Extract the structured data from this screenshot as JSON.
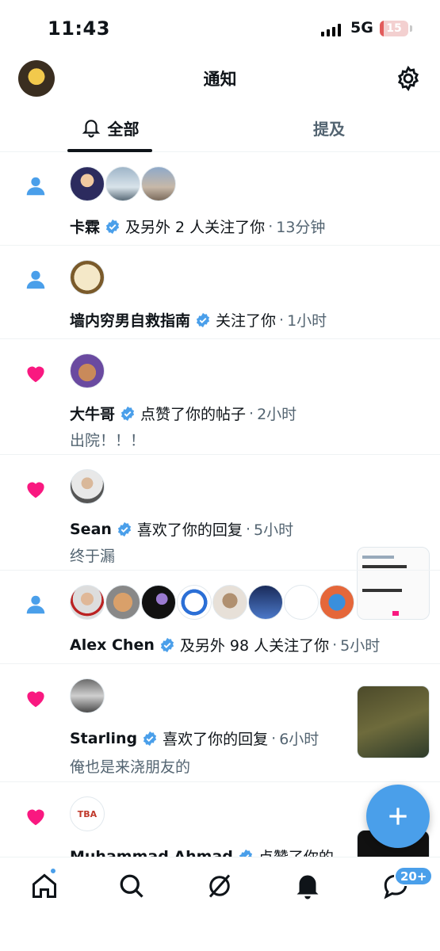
{
  "status_bar": {
    "time": "11:43",
    "network": "5G",
    "battery": "15",
    "battery_level": 0.15
  },
  "header": {
    "title": "通知"
  },
  "tabs": [
    {
      "label": "全部",
      "active": true
    },
    {
      "label": "提及",
      "active": false
    }
  ],
  "notifications": [
    {
      "type": "follow",
      "name": "卡霖",
      "action": "及另外 2 人关注了你",
      "dot": "·",
      "time": "13分钟"
    },
    {
      "type": "follow",
      "name": "墙内穷男自救指南",
      "action": "关注了你",
      "dot": "·",
      "time": "1小时"
    },
    {
      "type": "like",
      "name": "大牛哥",
      "action": "点赞了你的帖子",
      "dot": "·",
      "time": "2小时",
      "text": "出院！！！"
    },
    {
      "type": "like",
      "name": "Sean",
      "action": "喜欢了你的回复",
      "dot": "·",
      "time": "5小时",
      "text": "终于漏"
    },
    {
      "type": "follow",
      "name": "Alex Chen",
      "action": "及另外 98 人关注了你",
      "dot": "·",
      "time": "5小时"
    },
    {
      "type": "like",
      "name": "Starling",
      "action": "喜欢了你的回复",
      "dot": "·",
      "time": "6小时",
      "text": "俺也是来浇朋友的"
    },
    {
      "type": "like",
      "name": "Muhammad Ahmad",
      "action": "点赞了你的",
      "avatar_text": "TBA"
    }
  ],
  "nav": {
    "messages_badge": "20+"
  },
  "colors": {
    "accent": "#4a9fea",
    "like": "#f91880",
    "follow": "#4a9fea",
    "muted": "#536471"
  },
  "icons": [
    "user-icon",
    "heart-icon",
    "verified-icon",
    "gear-icon",
    "bell-icon",
    "home-icon",
    "search-icon",
    "grok-icon",
    "message-icon",
    "plus-icon"
  ]
}
